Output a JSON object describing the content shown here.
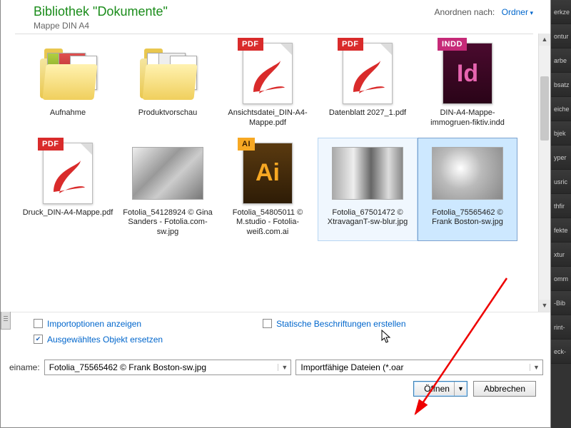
{
  "header": {
    "library_title": "Bibliothek \"Dokumente\"",
    "subfolder": "Mappe DIN A4",
    "arrange_label": "Anordnen nach:",
    "arrange_value": "Ordner"
  },
  "files": [
    {
      "name": "Aufnahme",
      "kind": "folder-photos"
    },
    {
      "name": "Produktvorschau",
      "kind": "folder-preview"
    },
    {
      "name": "Ansichtsdatei_DIN-A4-Mappe.pdf",
      "kind": "pdf"
    },
    {
      "name": "Datenblatt 2027_1.pdf",
      "kind": "pdf"
    },
    {
      "name": "DIN-A4-Mappe-immogruen-fiktiv.indd",
      "kind": "indd"
    },
    {
      "name": "Druck_DIN-A4-Mappe.pdf",
      "kind": "pdf"
    },
    {
      "name": "Fotolia_54128924 © Gina Sanders - Fotolia.com-sw.jpg",
      "kind": "photo-bw1"
    },
    {
      "name": "Fotolia_54805011 © M.studio - Fotolia-weiß.com.ai",
      "kind": "ai"
    },
    {
      "name": "Fotolia_67501472 © XtravaganT-sw-blur.jpg",
      "kind": "photo-bw2",
      "state": "hover"
    },
    {
      "name": "Fotolia_75565462 © Frank Boston-sw.jpg",
      "kind": "photo-bw3",
      "state": "selected"
    }
  ],
  "options": {
    "import_options": "Importoptionen anzeigen",
    "replace_selected": "Ausgewähltes Objekt ersetzen",
    "static_captions": "Statische Beschriftungen erstellen",
    "import_checked": false,
    "replace_checked": true,
    "static_checked": false
  },
  "bottom": {
    "filename_label": "einame:",
    "filename_value": "Fotolia_75565462 © Frank Boston-sw.jpg",
    "filter_value": "Importfähige Dateien (*.oar",
    "open_label": "Öffnen",
    "cancel_label": "Abbrechen"
  },
  "panels": [
    "erkze",
    "ontur",
    "arbe",
    "bsatz",
    "eiche",
    "bjek",
    "yper",
    "usric",
    "thfir",
    "fekte",
    "xtur",
    "omm",
    "-Bib",
    "rint-",
    "eck-"
  ]
}
